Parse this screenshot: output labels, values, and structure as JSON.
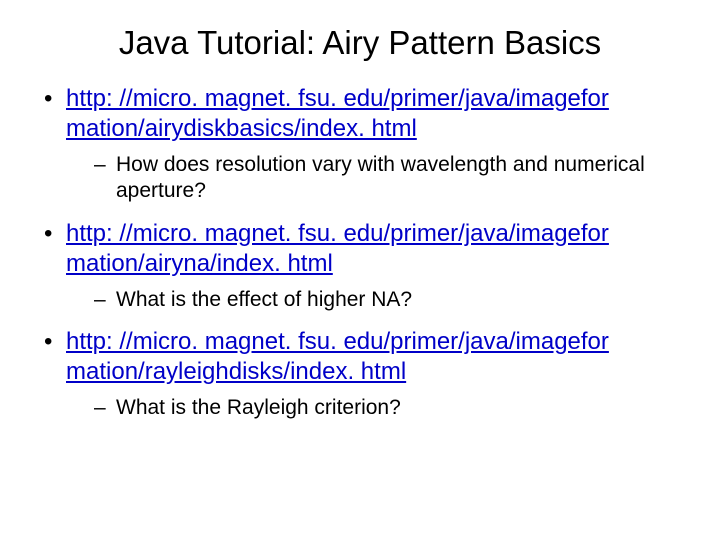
{
  "title": "Java Tutorial: Airy Pattern Basics",
  "items": [
    {
      "link": "http: //micro. magnet. fsu. edu/primer/java/imagefor mation/airydiskbasics/index. html",
      "sub": "How does resolution vary with wavelength and numerical aperture?"
    },
    {
      "link": "http: //micro. magnet. fsu. edu/primer/java/imagefor mation/airyna/index. html",
      "sub": "What is the effect of higher NA?"
    },
    {
      "link": "http: //micro. magnet. fsu. edu/primer/java/imagefor mation/rayleighdisks/index. html",
      "sub": "What is the Rayleigh criterion?"
    }
  ]
}
